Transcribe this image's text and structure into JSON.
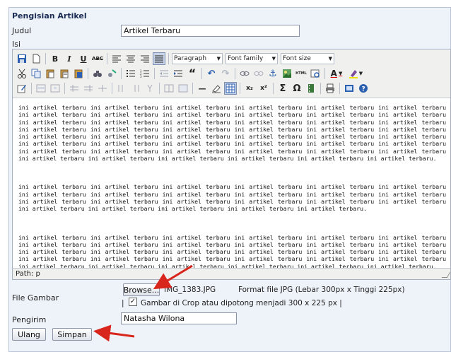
{
  "form": {
    "title": "Pengisian Artikel",
    "judul_label": "Judul",
    "judul_value": "Artikel Terbaru",
    "isi_label": "Isi",
    "file_label": "File Gambar",
    "browse_label": "Browse...",
    "file_name": "IMG_1383.JPG",
    "file_hint": "Format file JPG (Lebar 300px x Tinggi 225px)",
    "crop_prefix": "|",
    "crop_checked": true,
    "crop_label": "Gambar di Crop atau dipotong menjadi 300 x 225 px |",
    "pengirim_label": "Pengirim",
    "pengirim_value": "Natasha Wilona",
    "reset_label": "Ulang",
    "submit_label": "Simpan"
  },
  "editor": {
    "format_select": "Paragraph",
    "font_family_select": "Font family",
    "font_size_select": "Font size",
    "path_text": "Path: p",
    "paragraphs": [
      "ini artikel terbaru ini artikel terbaru ini artikel terbaru ini artikel terbaru ini artikel terbaru ini artikel terbaru ini artikel terbaru ini artikel terbaru ini artikel terbaru ini artikel terbaru ini artikel terbaru ini artikel terbaru ini artikel terbaru ini artikel terbaru ini artikel terbaru ini artikel terbaru ini artikel terbaru ini artikel terbaru ini artikel terbaru ini artikel terbaru ini artikel terbaru ini artikel terbaru ini artikel terbaru ini artikel terbaru ini artikel terbaru ini artikel terbaru ini artikel terbaru ini artikel terbaru ini artikel terbaru ini artikel terbaru ini artikel terbaru ini artikel terbaru ini artikel terbaru ini artikel terbaru ini artikel terbaru ini artikel terbaru ini artikel terbaru ini artikel terbaru ini artikel terbaru ini artikel terbaru ini artikel terbaru ini artikel terbaru ini artikel terbaru ini artikel terbaru ini artikel terbaru ini artikel terbaru ini artikel terbaru ini artikel terbaru.",
      "ini artikel terbaru ini artikel terbaru ini artikel terbaru ini artikel terbaru ini artikel terbaru ini artikel terbaru ini artikel terbaru ini artikel terbaru ini artikel terbaru ini artikel terbaru ini artikel terbaru ini artikel terbaru ini artikel terbaru ini artikel terbaru ini artikel terbaru ini artikel terbaru ini artikel terbaru ini artikel terbaru ini artikel terbaru ini artikel terbaru ini artikel terbaru ini artikel terbaru ini artikel terbaru.",
      "ini artikel terbaru ini artikel terbaru ini artikel terbaru ini artikel terbaru ini artikel terbaru ini artikel terbaru ini artikel terbaru ini artikel terbaru ini artikel terbaru ini artikel terbaru ini artikel terbaru ini artikel terbaru ini artikel terbaru ini artikel terbaru ini artikel terbaru ini artikel terbaru ini artikel terbaru ini artikel terbaru ini artikel terbaru ini artikel terbaru ini artikel terbaru ini artikel terbaru ini artikel terbaru ini artikel terbaru ini artikel terbaru ini artikel terbaru ini artikel terbaru ini artikel terbaru ini artikel terbaru ini artikel terbaru."
    ],
    "toolbar_row1": [
      "save-icon",
      "new-document-icon",
      "bold-icon",
      "italic-icon",
      "underline-icon",
      "strikethrough-icon",
      "align-left-icon",
      "align-center-icon",
      "align-right-icon",
      "align-justify-icon"
    ],
    "glyphs": {
      "bold": "B",
      "italic": "I",
      "underline": "U",
      "strike": "ABC",
      "quote": "“",
      "undo": "↶",
      "redo": "↷",
      "hr": "—",
      "sub": "x₂",
      "sup": "x²",
      "sigma": "Σ",
      "omega": "Ω",
      "html": "HTML"
    }
  },
  "colors": {
    "frame_bg": "#eef2f9",
    "arrow": "#d9261c"
  }
}
